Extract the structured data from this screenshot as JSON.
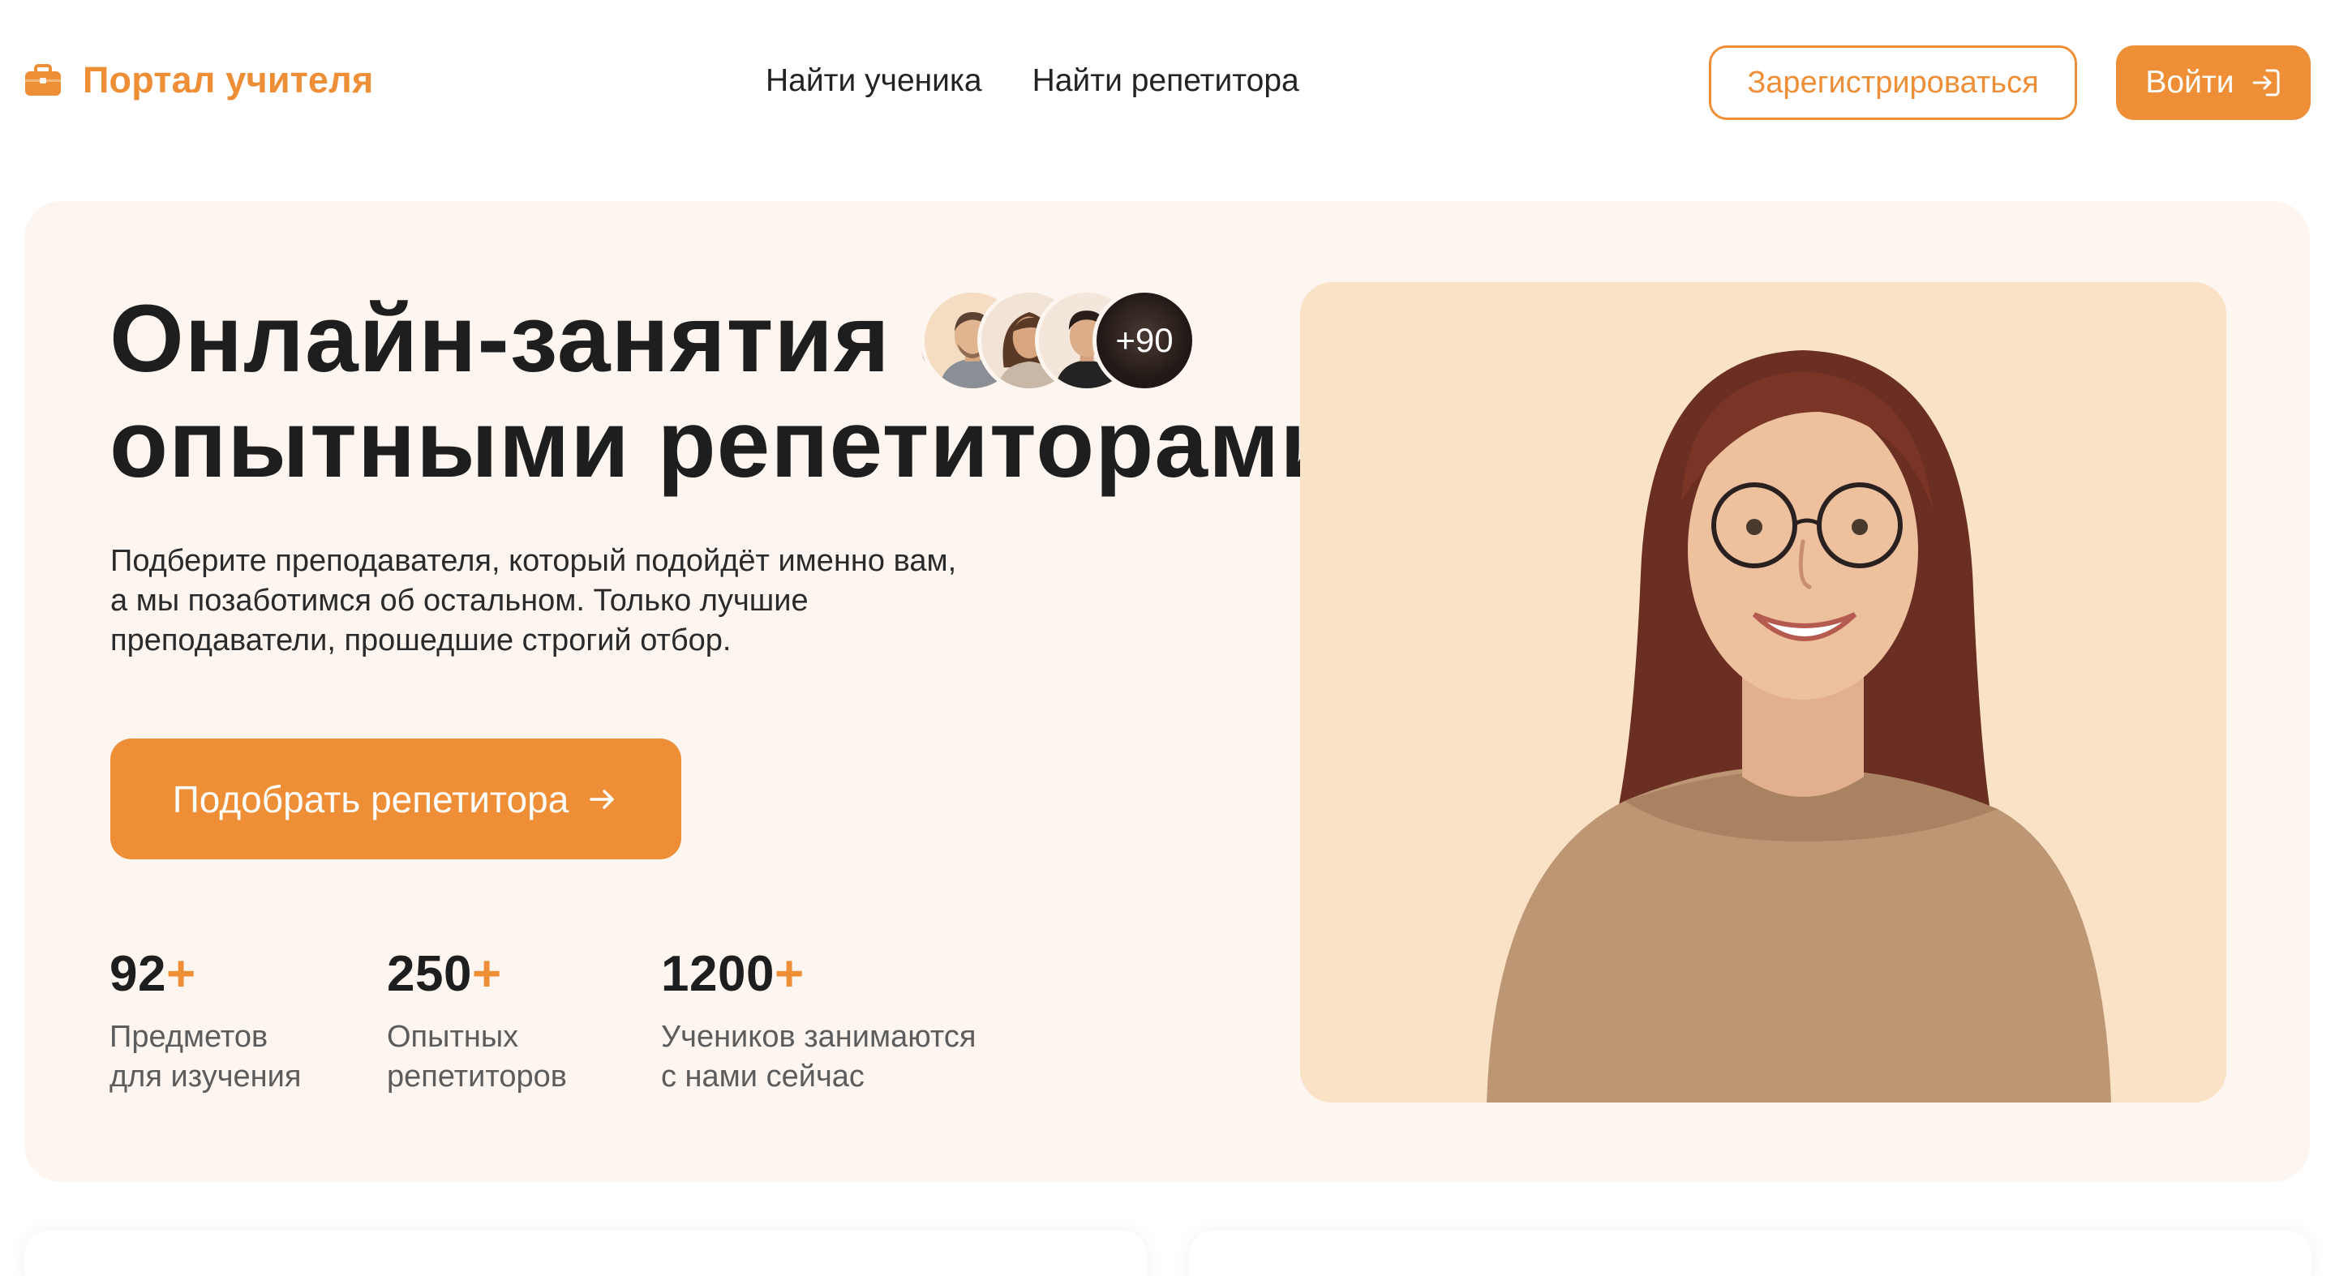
{
  "header": {
    "logo_text": "Портал учителя",
    "nav": [
      {
        "label": "Найти ученика"
      },
      {
        "label": "Найти репетитора"
      }
    ],
    "register_label": "Зарегистрироваться",
    "login_label": "Войти"
  },
  "hero": {
    "title_line1": "Онлайн-занятия с",
    "title_line2": "опытными репетиторами",
    "avatars_more": "+90",
    "subtitle": "Подберите преподавателя, который подойдёт именно вам, а мы позаботимся об остальном. Только лучшие преподаватели, прошедшие строгий отбор.",
    "cta_label": "Подобрать репетитора",
    "stats": [
      {
        "number": "92",
        "plus": "+",
        "label_line1": "Предметов",
        "label_line2": "для изучения"
      },
      {
        "number": "250",
        "plus": "+",
        "label_line1": "Опытных",
        "label_line2": "репетиторов"
      },
      {
        "number": "1200",
        "plus": "+",
        "label_line1": "Учеников занимаются",
        "label_line2": "с нами сейчас"
      }
    ]
  },
  "icons": {
    "logo": "briefcase-icon",
    "login": "login-icon",
    "cta": "arrow-right-icon"
  },
  "colors": {
    "accent": "#EE8E36",
    "hero_bg": "#FDF6F0",
    "image_bg": "#FAE2C6",
    "text_dark": "#1E1E1E",
    "text_muted": "#5C5C5C"
  }
}
